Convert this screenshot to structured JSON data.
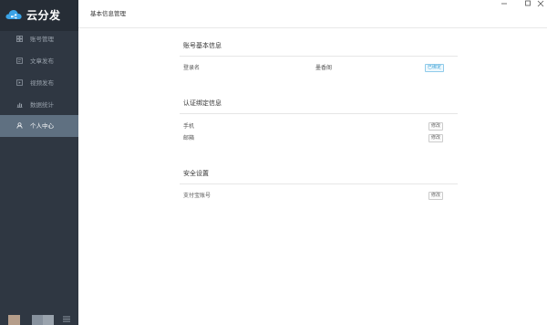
{
  "app": {
    "name": "云分发"
  },
  "sidebar": {
    "items": [
      {
        "label": "账号管理",
        "icon": "grid-icon",
        "active": false
      },
      {
        "label": "文章发布",
        "icon": "article-icon",
        "active": false
      },
      {
        "label": "视频发布",
        "icon": "video-icon",
        "active": false
      },
      {
        "label": "数据统计",
        "icon": "stats-icon",
        "active": false
      },
      {
        "label": "个人中心",
        "icon": "user-icon",
        "active": true
      }
    ]
  },
  "header": {
    "title": "基本信息管理"
  },
  "sections": {
    "account": {
      "title": "账号基本信息",
      "rows": [
        {
          "label": "登录名",
          "value": "墨香阁",
          "badge": "已绑定"
        }
      ]
    },
    "binding": {
      "title": "认证绑定信息",
      "rows": [
        {
          "label": "手机",
          "action": "修改"
        },
        {
          "label": "邮箱",
          "action": "修改"
        }
      ]
    },
    "security": {
      "title": "安全设置",
      "rows": [
        {
          "label": "支付宝账号",
          "action": "修改"
        }
      ]
    }
  },
  "colors": {
    "sidebar": "#2f3742",
    "brand_bg": "#262d36",
    "active": "#5f7081",
    "badge": "#3aa0d6"
  }
}
